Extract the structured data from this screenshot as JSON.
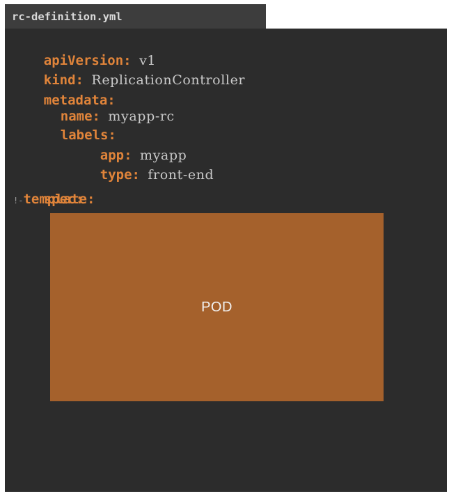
{
  "tab": {
    "filename": "rc-definition.yml"
  },
  "yaml": {
    "apiVersion_key": "apiVersion:",
    "apiVersion_val": "v1",
    "kind_key": "kind:",
    "kind_val": "ReplicationController",
    "metadata_key": "metadata:",
    "name_key": "name:",
    "name_val": "myapp-rc",
    "labels_key": "labels:",
    "app_key": "app:",
    "app_val": "myapp",
    "type_key": "type:",
    "type_val": "front-end",
    "spec_key": "spec:",
    "template_caret": "!-",
    "template_key": "template:"
  },
  "pod": {
    "label": "POD"
  },
  "colors": {
    "key": "#e0843a",
    "value": "#c9c9c9",
    "editor_bg": "#2c2c2c",
    "tab_bg": "#3d3d3d",
    "pod_bg": "#a5612c"
  }
}
